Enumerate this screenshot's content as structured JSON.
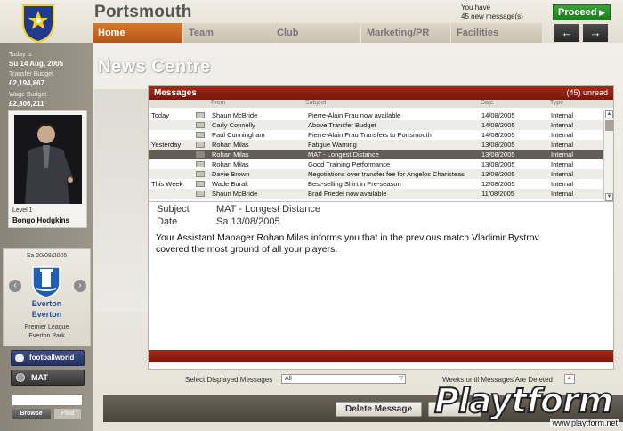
{
  "header": {
    "club_name": "Portsmouth",
    "message_notice_line1": "You have",
    "message_notice_line2": "45 new message(s)",
    "proceed_label": "Proceed",
    "nav_back": "←",
    "nav_forward": "→"
  },
  "tabs": [
    {
      "label": "Home",
      "active": true
    },
    {
      "label": "Team",
      "active": false
    },
    {
      "label": "Club",
      "active": false
    },
    {
      "label": "Marketing/PR",
      "active": false
    },
    {
      "label": "Facilities",
      "active": false
    }
  ],
  "sidebar": {
    "today_label": "Today is",
    "today_value": "Su 14 Aug, 2005",
    "transfer_label": "Transfer Budget",
    "transfer_value": "£2,194,867",
    "wage_label": "Wage Budget",
    "wage_value": "£2,306,211",
    "manager_level": "Level 1",
    "manager_name": "Bongo Hodgkins",
    "fixture_date": "Sa 20/08/2005",
    "fixture_team1": "Everton",
    "fixture_team2": "Everton",
    "fixture_league": "Premier League",
    "fixture_venue": "Everton Park",
    "footballworld_label": "footballworld",
    "mat_label": "MAT",
    "browse_label": "Browse",
    "find_label": "Find"
  },
  "page_title": "News Centre",
  "messages": {
    "title": "Messages",
    "unread": "(45) unread",
    "columns": {
      "from": "From",
      "subject": "Subject",
      "date": "Date",
      "type": "Type"
    },
    "rows": [
      {
        "group": "Today",
        "from": "Shaun McBride",
        "subject": "Pierre-Alain Frau now available",
        "date": "14/08/2005",
        "type": "Internal"
      },
      {
        "group": "",
        "from": "Carly Connelly",
        "subject": "Above Transfer Budget",
        "date": "14/08/2005",
        "type": "Internal"
      },
      {
        "group": "",
        "from": "Paul Cunningham",
        "subject": "Pierre-Alain Frau Transfers to Portsmouth",
        "date": "14/08/2005",
        "type": "Internal"
      },
      {
        "group": "Yesterday",
        "from": "Rohan Milas",
        "subject": "Fatigue Warning",
        "date": "13/08/2005",
        "type": "Internal"
      },
      {
        "group": "",
        "from": "Rohan Milas",
        "subject": "MAT - Longest Distance",
        "date": "13/08/2005",
        "type": "Internal",
        "selected": true
      },
      {
        "group": "",
        "from": "Rohan Milas",
        "subject": "Good Training Performance",
        "date": "13/08/2005",
        "type": "Internal"
      },
      {
        "group": "",
        "from": "Davie Brown",
        "subject": "Negotiations over transfer fee for Angelos Charisteas",
        "date": "13/08/2005",
        "type": "Internal"
      },
      {
        "group": "This Week",
        "from": "Wade Burak",
        "subject": "Best-selling Shirt in Pre-season",
        "date": "12/08/2005",
        "type": "Internal"
      },
      {
        "group": "",
        "from": "Shaun McBride",
        "subject": "Brad Friedel now available",
        "date": "11/08/2005",
        "type": "Internal"
      }
    ]
  },
  "detail": {
    "subject_label": "Subject",
    "subject_value": "MAT - Longest Distance",
    "date_label": "Date",
    "date_value": "Sa 13/08/2005",
    "body": "Your Assistant Manager Rohan Milas informs you that in the previous match Vladimir Bystrov covered the most ground of all your players."
  },
  "filter": {
    "select_label": "Select Displayed Messages",
    "select_value": "All",
    "weeks_label": "Weeks until Messages Are Deleted",
    "weeks_value": "4"
  },
  "actions": {
    "delete_label": "Delete Message"
  },
  "watermark": {
    "text": "Playtform",
    "url": "www.playtform.net"
  },
  "colors": {
    "accent_orange": "#c8662a",
    "message_header_red": "#8c1f10",
    "proceed_green": "#2a8f2a",
    "selected_row": "#645c56"
  }
}
